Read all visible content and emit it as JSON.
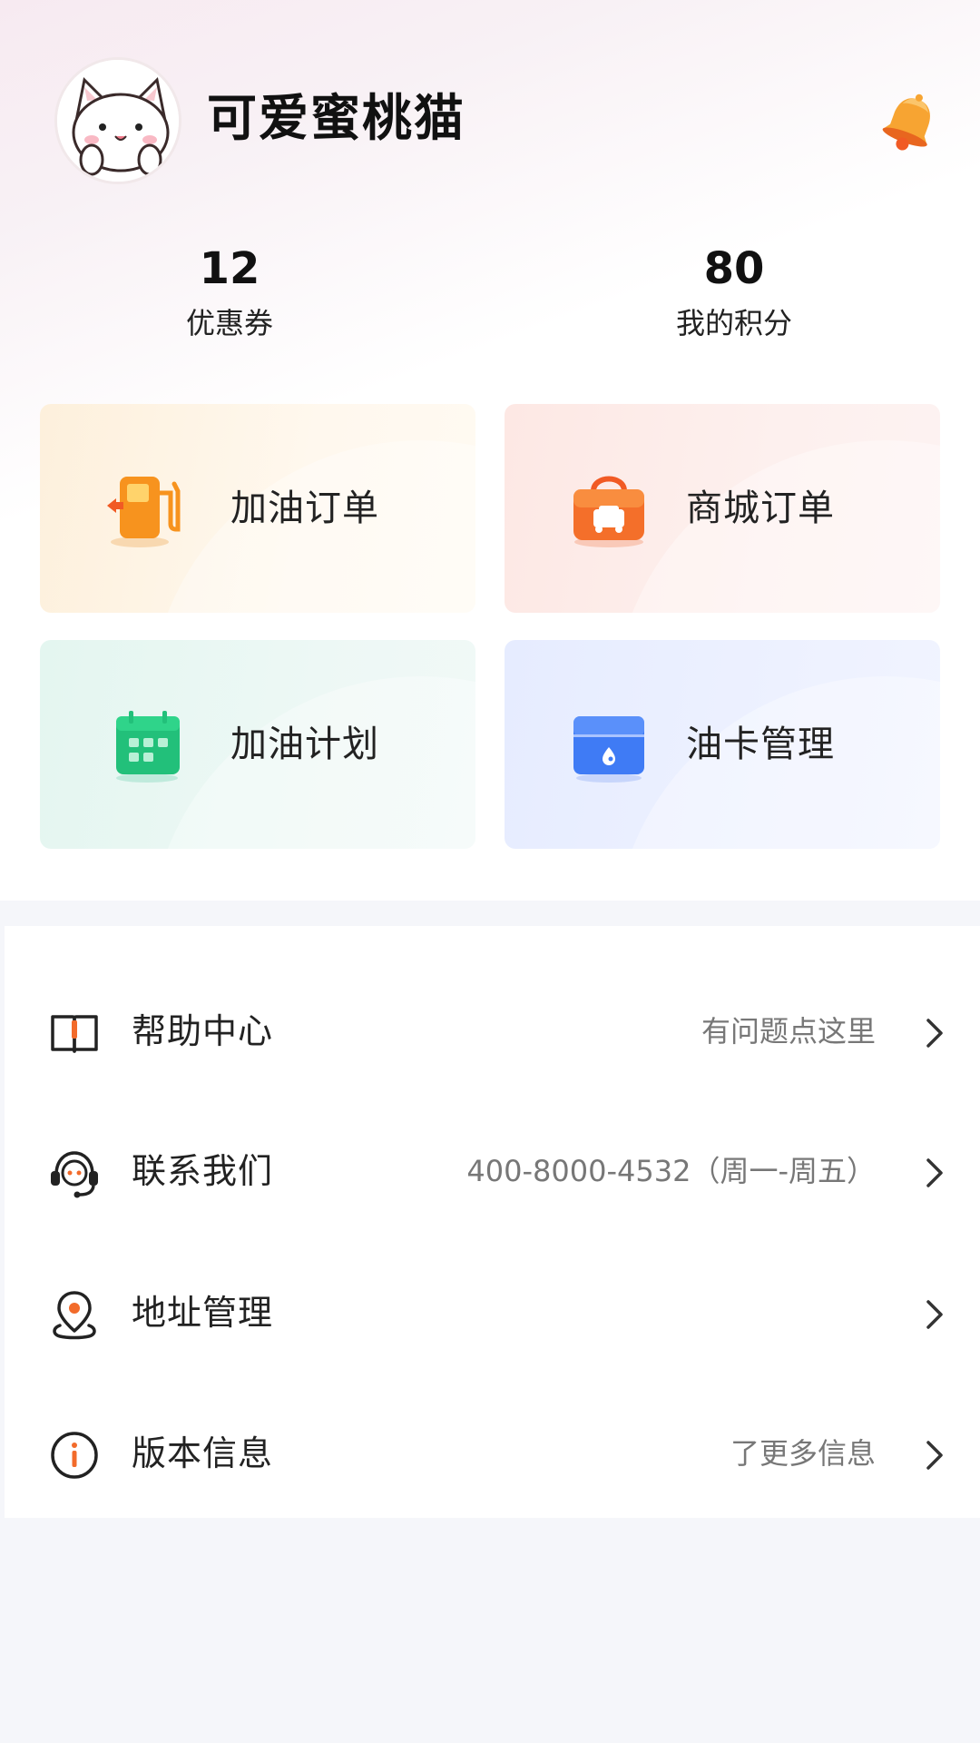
{
  "profile": {
    "username": "可爱蜜桃猫",
    "avatar_icon": "cat-avatar",
    "notification_icon": "bell-icon"
  },
  "stats": {
    "coupons": {
      "value": "12",
      "label": "优惠券"
    },
    "points": {
      "value": "80",
      "label": "我的积分"
    }
  },
  "cards": [
    {
      "label": "加油订单",
      "icon": "fuel-pump-icon",
      "color": "#f7931e"
    },
    {
      "label": "商城订单",
      "icon": "shopping-bag-icon",
      "color": "#f26b2b"
    },
    {
      "label": "加油计划",
      "icon": "calendar-icon",
      "color": "#22c07a"
    },
    {
      "label": "油卡管理",
      "icon": "card-icon",
      "color": "#3f7bf5"
    }
  ],
  "menu": [
    {
      "label": "帮助中心",
      "hint": "有问题点这里",
      "icon": "book-icon"
    },
    {
      "label": "联系我们",
      "hint": "400-8000-4532（周一-周五）",
      "icon": "headset-icon"
    },
    {
      "label": "地址管理",
      "hint": "",
      "icon": "location-pin-icon"
    },
    {
      "label": "版本信息",
      "hint": "了更多信息",
      "icon": "info-icon"
    }
  ],
  "colors": {
    "accent": "#f26b2b",
    "page_background": "#f5f6fa"
  }
}
